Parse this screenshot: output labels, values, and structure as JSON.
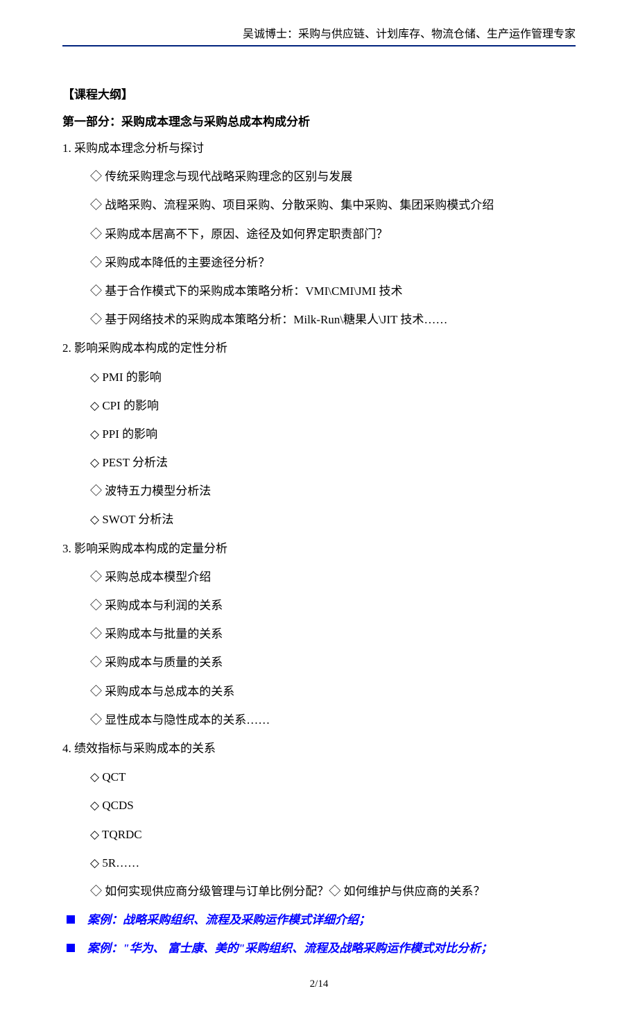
{
  "header": {
    "text": "吴诚博士：采购与供应链、计划库存、物流仓储、生产运作管理专家"
  },
  "outline": {
    "section_label": "【课程大纲】",
    "part_title": "第一部分：采购成本理念与采购总成本构成分析",
    "sections": [
      {
        "num": "1.",
        "title": "采购成本理念分析与探讨",
        "items": [
          "传统采购理念与现代战略采购理念的区别与发展",
          "战略采购、流程采购、项目采购、分散采购、集中采购、集团采购模式介绍",
          "采购成本居高不下，原因、途径及如何界定职责部门？",
          "采购成本降低的主要途径分析？",
          "基于合作模式下的采购成本策略分析：VMI\\CMI\\JMI 技术",
          "基于网络技术的采购成本策略分析：Milk-Run\\糖果人\\JIT 技术……"
        ]
      },
      {
        "num": "2.",
        "title": "影响采购成本构成的定性分析",
        "items": [
          "PMI 的影响",
          "CPI 的影响",
          "PPI 的影响",
          "PEST 分析法",
          "波特五力模型分析法",
          "SWOT 分析法"
        ]
      },
      {
        "num": "3.",
        "title": "影响采购成本构成的定量分析",
        "items": [
          "采购总成本模型介绍",
          "采购成本与利润的关系",
          "采购成本与批量的关系",
          "采购成本与质量的关系",
          "采购成本与总成本的关系",
          "显性成本与隐性成本的关系……"
        ]
      },
      {
        "num": "4.",
        "title": "绩效指标与采购成本的关系",
        "items": [
          "QCT",
          "QCDS",
          "TQRDC",
          "5R……",
          "如何实现供应商分级管理与订单比例分配？◇ 如何维护与供应商的关系？"
        ]
      }
    ],
    "cases": [
      "案例：战略采购组织、流程及采购运作模式详细介绍；",
      "案例：\"华为、 富士康、美的\"采购组织、流程及战略采购运作模式对比分析；"
    ]
  },
  "footer": {
    "page_number": "2/14"
  }
}
